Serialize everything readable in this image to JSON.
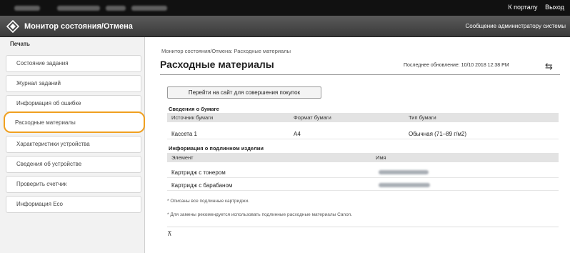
{
  "topbar": {
    "portal_link": "К порталу",
    "logout_link": "Выход"
  },
  "header": {
    "app_title": "Монитор состояния/Отмена",
    "admin_message": "Сообщение администратору системы",
    "logo_icon": "canon-diamond-icon"
  },
  "sidebar": {
    "heading": "Печать",
    "items": [
      {
        "label": "Состояние задания"
      },
      {
        "label": "Журнал заданий"
      },
      {
        "label": "Информация об ошибке"
      },
      {
        "label": "Расходные материалы"
      },
      {
        "label": "Характеристики устройства"
      },
      {
        "label": "Сведения об устройстве"
      },
      {
        "label": "Проверить счетчик"
      },
      {
        "label": "Информация Eco"
      }
    ],
    "active_index": 3,
    "highlight_color": "#f0a020"
  },
  "main": {
    "breadcrumb": "Монитор состояния/Отмена: Расходные материалы",
    "title": "Расходные материалы",
    "last_update": "Последнее обновление: 10/10 2018 12:38 PM",
    "refresh_icon": "refresh-icon",
    "purchase_button": "Перейти на сайт для совершения покупок",
    "paper": {
      "heading": "Сведения о бумаге",
      "columns": [
        "Источник бумаги",
        "Формат бумаги",
        "Тип бумаги"
      ],
      "rows": [
        [
          "Кассета 1",
          "A4",
          "Обычная (71–89 г/м2)"
        ]
      ]
    },
    "genuine": {
      "heading": "Информация о подлинном изделии",
      "columns": [
        "Элемент",
        "Имя"
      ],
      "rows": [
        {
          "item": "Картридж с тонером"
        },
        {
          "item": "Картридж с барабаном"
        }
      ]
    },
    "notes": [
      "* Описаны все подлинные картриджи.",
      "* Для замены рекомендуется использовать подлинные расходные материалы Canon."
    ],
    "back_to_top_icon": "back-to-top-icon"
  }
}
